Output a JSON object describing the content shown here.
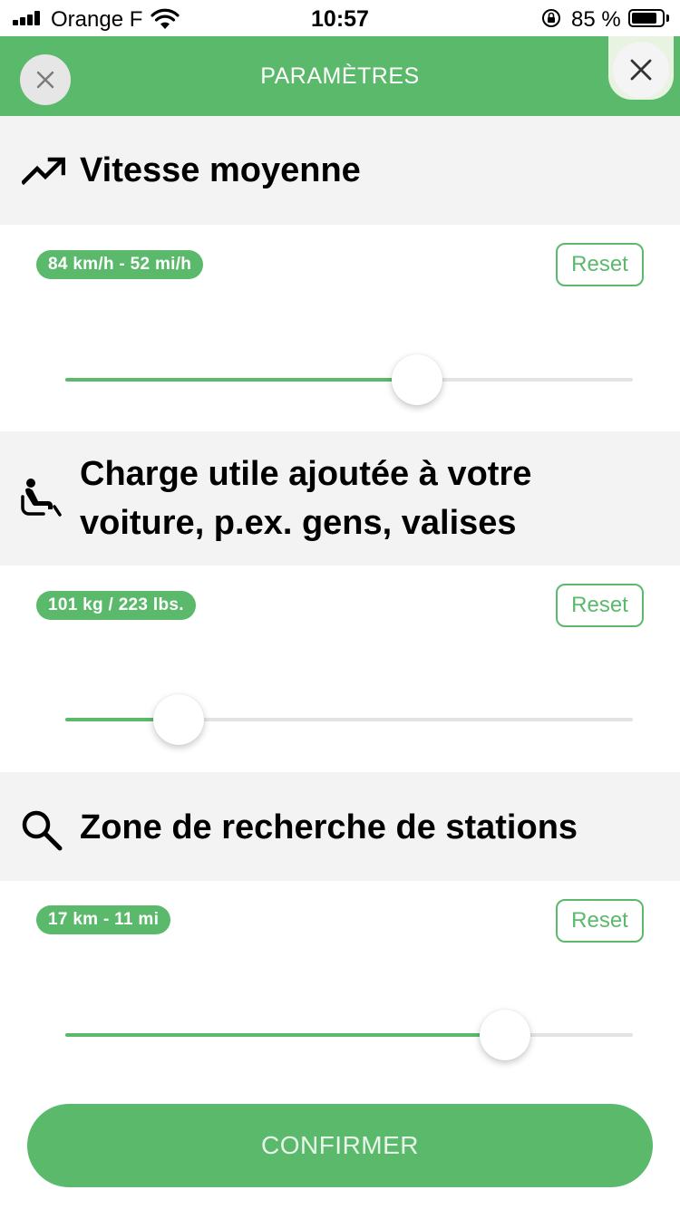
{
  "status_bar": {
    "carrier": "Orange F",
    "time": "10:57",
    "battery_percent": "85 %",
    "battery_level": 0.85
  },
  "header": {
    "title": "PARAMÈTRES"
  },
  "sections": [
    {
      "icon": "trending-up-icon",
      "title": "Vitesse moyenne",
      "value": "84 km/h - 52 mi/h",
      "reset_label": "Reset",
      "slider_level": 0.62
    },
    {
      "icon": "seated-person-icon",
      "title_line1": "Charge utile ajoutée à votre",
      "title_line2": "voiture, p.ex. gens, valises",
      "value": "101 kg / 223 lbs.",
      "reset_label": "Reset",
      "slider_level": 0.2
    },
    {
      "icon": "search-icon",
      "title": "Zone de recherche de stations",
      "value": "17 km - 11 mi",
      "reset_label": "Reset",
      "slider_level": 0.775
    }
  ],
  "confirm_label": "CONFIRMER",
  "colors": {
    "accent": "#5bb96b",
    "section_background": "#f3f3f3",
    "track": "#e3e3e3"
  }
}
